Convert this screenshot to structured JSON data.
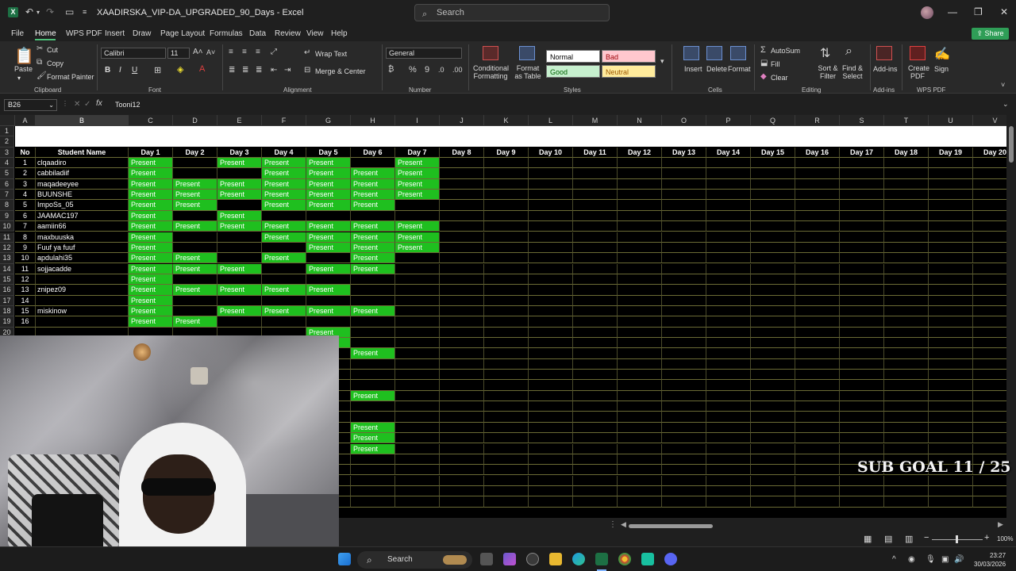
{
  "app": {
    "logo_letter": "X",
    "title": "XAADIRSKA_VIP-DA_UPGRADED_90_Days  -  Excel",
    "search_placeholder": "Search",
    "share_label": "Share"
  },
  "menu": {
    "items": [
      "File",
      "Home",
      "WPS PDF",
      "Insert",
      "Draw",
      "Page Layout",
      "Formulas",
      "Data",
      "Review",
      "View",
      "Help"
    ],
    "active": "Home"
  },
  "ribbon": {
    "clipboard": {
      "paste": "Paste",
      "cut": "Cut",
      "copy": "Copy",
      "format_painter": "Format Painter",
      "label": "Clipboard"
    },
    "font": {
      "name": "Calibri",
      "size": "11",
      "bold": "B",
      "italic": "I",
      "underline": "U",
      "label": "Font"
    },
    "alignment": {
      "wrap_text": "Wrap Text",
      "merge_center": "Merge & Center",
      "label": "Alignment"
    },
    "number": {
      "format": "General",
      "label": "Number"
    },
    "styles": {
      "conditional": "Conditional Formatting",
      "format_table": "Format as Table",
      "normal": "Normal",
      "bad": "Bad",
      "good": "Good",
      "neutral": "Neutral",
      "label": "Styles"
    },
    "cells": {
      "insert": "Insert",
      "delete": "Delete",
      "format": "Format",
      "label": "Cells"
    },
    "editing": {
      "autosum": "AutoSum",
      "fill": "Fill",
      "clear": "Clear",
      "sort_filter": "Sort & Filter",
      "find_select": "Find & Select",
      "label": "Editing"
    },
    "addins": {
      "addins": "Add-ins",
      "label": "Add-ins"
    },
    "wps": {
      "create_pdf": "Create PDF",
      "sign": "Sign",
      "label": "WPS PDF"
    }
  },
  "formula_bar": {
    "name_box": "B26",
    "fx": "fx",
    "content": "Tooni12"
  },
  "sheet": {
    "columns": [
      "A",
      "B",
      "C",
      "D",
      "E",
      "F",
      "G",
      "H",
      "I",
      "J",
      "K",
      "L",
      "M",
      "N",
      "O",
      "P",
      "Q",
      "R",
      "S",
      "T",
      "U",
      "V"
    ],
    "header_row": [
      "No",
      "Student Name",
      "Day 1",
      "Day 2",
      "Day 3",
      "Day 4",
      "Day 5",
      "Day 6",
      "Day 7",
      "Day 8",
      "Day 9",
      "Day 10",
      "Day 11",
      "Day 12",
      "Day 13",
      "Day 14",
      "Day 15",
      "Day 16",
      "Day 17",
      "Day 18",
      "Day 19",
      "Day 20"
    ],
    "present_label": "Present",
    "rows": [
      {
        "row": "4",
        "no": "1",
        "name": " clqaadiro",
        "days": [
          1,
          0,
          1,
          1,
          1,
          0,
          1
        ]
      },
      {
        "row": "5",
        "no": "2",
        "name": "cabbiladiif",
        "days": [
          1,
          0,
          0,
          1,
          1,
          1,
          1
        ]
      },
      {
        "row": "6",
        "no": "3",
        "name": "maqadeeyee",
        "days": [
          1,
          1,
          1,
          1,
          1,
          1,
          1
        ]
      },
      {
        "row": "7",
        "no": "4",
        "name": "BUUNSHE",
        "days": [
          1,
          1,
          1,
          1,
          1,
          1,
          1
        ]
      },
      {
        "row": "8",
        "no": "5",
        "name": "ImpoSs_05",
        "days": [
          1,
          1,
          0,
          1,
          1,
          1,
          0
        ]
      },
      {
        "row": "9",
        "no": "6",
        "name": "JAAMAC197",
        "days": [
          1,
          0,
          1,
          0,
          0,
          0,
          0
        ]
      },
      {
        "row": "10",
        "no": "7",
        "name": "aamiin66",
        "days": [
          1,
          1,
          1,
          1,
          1,
          1,
          1
        ]
      },
      {
        "row": "11",
        "no": "8",
        "name": "maxbuuska",
        "days": [
          1,
          0,
          0,
          1,
          1,
          1,
          1
        ]
      },
      {
        "row": "12",
        "no": "9",
        "name": "Fuuf ya fuuf",
        "days": [
          1,
          0,
          0,
          0,
          1,
          1,
          1
        ]
      },
      {
        "row": "13",
        "no": "10",
        "name": "apdulahi35",
        "days": [
          1,
          1,
          0,
          1,
          0,
          1,
          0
        ]
      },
      {
        "row": "14",
        "no": "11",
        "name": "sojjacadde",
        "days": [
          1,
          1,
          1,
          0,
          1,
          1,
          0
        ]
      },
      {
        "row": "15",
        "no": "12",
        "name": "",
        "days": [
          1,
          0,
          0,
          0,
          0,
          0,
          0
        ]
      },
      {
        "row": "16",
        "no": "13",
        "name": "znipez09",
        "days": [
          1,
          1,
          1,
          1,
          1,
          0,
          0
        ]
      },
      {
        "row": "17",
        "no": "14",
        "name": "",
        "days": [
          1,
          0,
          0,
          0,
          0,
          0,
          0
        ]
      },
      {
        "row": "18",
        "no": "15",
        "name": "miskinow",
        "days": [
          1,
          0,
          1,
          1,
          1,
          1,
          0
        ]
      },
      {
        "row": "19",
        "no": "16",
        "name": "",
        "days": [
          1,
          1,
          0,
          0,
          0,
          0,
          0
        ]
      },
      {
        "row": "20",
        "no": "",
        "name": "",
        "days": [
          0,
          0,
          0,
          0,
          1,
          0,
          0
        ]
      },
      {
        "row": "21",
        "no": "",
        "name": "",
        "days": [
          0,
          0,
          0,
          0,
          1,
          0,
          0
        ]
      },
      {
        "row": "22",
        "no": "",
        "name": "",
        "days": [
          0,
          0,
          0,
          0,
          0,
          1,
          0
        ]
      },
      {
        "row": "23",
        "no": "",
        "name": "",
        "days": [
          0,
          0,
          0,
          0,
          0,
          0,
          0
        ]
      },
      {
        "row": "24",
        "no": "",
        "name": "",
        "days": [
          0,
          0,
          0,
          0,
          0,
          0,
          0
        ]
      },
      {
        "row": "25",
        "no": "",
        "name": "",
        "days": [
          0,
          0,
          0,
          0,
          0,
          0,
          0
        ]
      },
      {
        "row": "26",
        "no": "",
        "name": "",
        "days": [
          0,
          0,
          0,
          0,
          0,
          1,
          0
        ]
      },
      {
        "row": "27",
        "no": "",
        "name": "",
        "days": [
          0,
          0,
          0,
          0,
          0,
          0,
          0
        ]
      },
      {
        "row": "28",
        "no": "",
        "name": "",
        "days": [
          0,
          0,
          0,
          0,
          0,
          0,
          0
        ]
      },
      {
        "row": "29",
        "no": "",
        "name": "",
        "days": [
          0,
          0,
          0,
          0,
          0,
          1,
          0
        ]
      },
      {
        "row": "30",
        "no": "",
        "name": "",
        "days": [
          0,
          0,
          0,
          0,
          0,
          1,
          0
        ]
      },
      {
        "row": "31",
        "no": "",
        "name": "",
        "days": [
          0,
          0,
          0,
          0,
          0,
          1,
          0
        ]
      },
      {
        "row": "32",
        "no": "",
        "name": "",
        "days": [
          0,
          0,
          0,
          0,
          0,
          0,
          0
        ]
      },
      {
        "row": "33",
        "no": "",
        "name": "",
        "days": [
          0,
          0,
          0,
          0,
          0,
          0,
          0
        ]
      },
      {
        "row": "34",
        "no": "",
        "name": "",
        "days": [
          0,
          0,
          0,
          0,
          0,
          0,
          0
        ]
      },
      {
        "row": "35",
        "no": "",
        "name": "",
        "days": [
          0,
          0,
          0,
          0,
          0,
          0,
          0
        ]
      },
      {
        "row": "36",
        "no": "",
        "name": "",
        "days": [
          0,
          0,
          0,
          0,
          0,
          0,
          0
        ]
      }
    ],
    "hidden_present_rows": [
      "22",
      "26",
      "29",
      "30",
      "31"
    ]
  },
  "overlay": {
    "sub_goal": "SUB GOAL 11 / 25"
  },
  "status": {
    "zoom": "100%"
  },
  "taskbar": {
    "search": "Search",
    "time": "23:27",
    "date": "30/03/2026"
  }
}
